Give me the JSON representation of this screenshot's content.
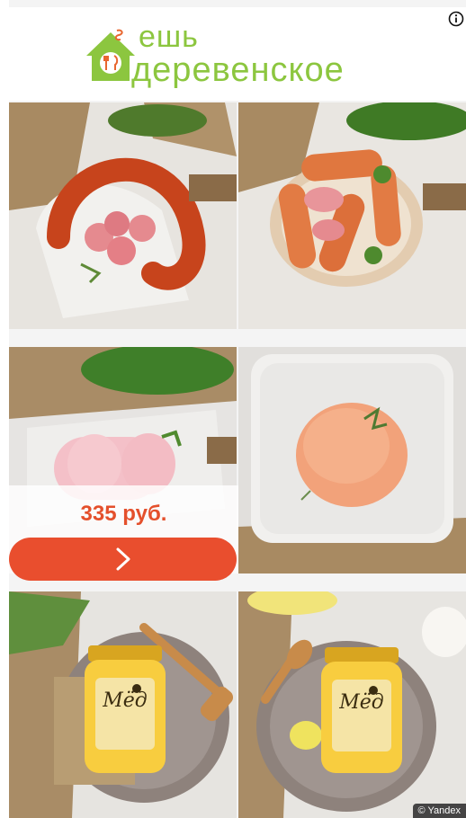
{
  "brand": {
    "line1": "ешь",
    "line2": "деревенское",
    "color": "#8cc63f",
    "accent": "#e8662f"
  },
  "header": {
    "info_icon": "info-icon"
  },
  "products": [
    {
      "name": "sausage-ring"
    },
    {
      "name": "sausages"
    },
    {
      "name": "bologna"
    },
    {
      "name": "minced-meat"
    },
    {
      "name": "honey-jar-left"
    },
    {
      "name": "honey-jar-right"
    }
  ],
  "honey_label": {
    "title": "Мёд"
  },
  "offer": {
    "price": "335 руб.",
    "button_icon": "chevron-right-icon",
    "button_color": "#e94e2e"
  },
  "attribution": {
    "text": "© Yandex"
  }
}
